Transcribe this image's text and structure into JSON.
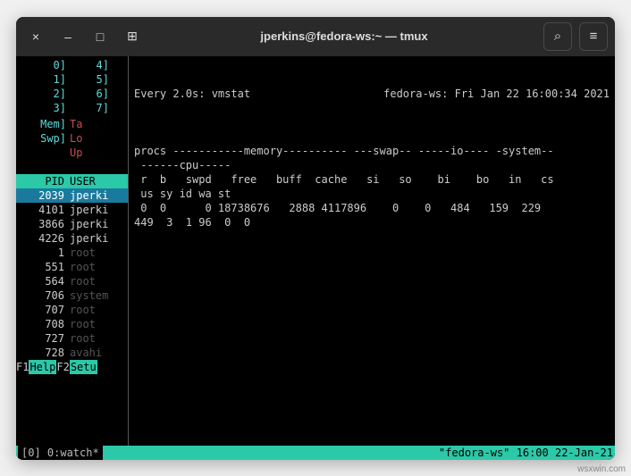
{
  "titlebar": {
    "close": "×",
    "minimize": "–",
    "maximize": "□",
    "newtab": "⊞",
    "title": "jperkins@fedora-ws:~ — tmux",
    "search": "⌕",
    "menu": "≡"
  },
  "left": {
    "cpu": [
      {
        "l": "0]",
        "r": "4]"
      },
      {
        "l": "1]",
        "r": "5]"
      },
      {
        "l": "2]",
        "r": "6]"
      },
      {
        "l": "3]",
        "r": "7]"
      }
    ],
    "mem": [
      {
        "l": "Mem]",
        "r": "Ta"
      },
      {
        "l": "Swp]",
        "r": "Lo"
      },
      {
        "l": "",
        "r": "Up"
      }
    ],
    "header": {
      "pid": "PID",
      "user": "USER"
    },
    "procs": [
      {
        "pid": "2039",
        "user": "jperki",
        "sel": true
      },
      {
        "pid": "4101",
        "user": "jperki"
      },
      {
        "pid": "3866",
        "user": "jperki"
      },
      {
        "pid": "4226",
        "user": "jperki"
      },
      {
        "pid": "1",
        "user": "root",
        "dim": true
      },
      {
        "pid": "551",
        "user": "root",
        "dim": true
      },
      {
        "pid": "564",
        "user": "root",
        "dim": true
      },
      {
        "pid": "706",
        "user": "system",
        "dim": true
      },
      {
        "pid": "707",
        "user": "root",
        "dim": true
      },
      {
        "pid": "708",
        "user": "root",
        "dim": true
      },
      {
        "pid": "727",
        "user": "root",
        "dim": true
      },
      {
        "pid": "728",
        "user": "avahi",
        "dim": true
      }
    ],
    "fn": [
      {
        "key": "F1",
        "lbl": "Help "
      },
      {
        "key": "F2",
        "lbl": "Setu"
      }
    ]
  },
  "right": {
    "watch_l": "Every 2.0s: vmstat",
    "watch_r": "fedora-ws: Fri Jan 22 16:00:34 2021",
    "lines": [
      "",
      "procs -----------memory---------- ---swap-- -----io---- -system--",
      " ------cpu-----",
      " r  b   swpd   free   buff  cache   si   so    bi    bo   in   cs",
      " us sy id wa st",
      " 0  0      0 18738676   2888 4117896    0    0   484   159  229 ",
      "449  3  1 96  0  0"
    ]
  },
  "status": {
    "left": "[0] 0:watch*",
    "right": "\"fedora-ws\" 16:00 22-Jan-21"
  },
  "watermark": "wsxwin.com"
}
